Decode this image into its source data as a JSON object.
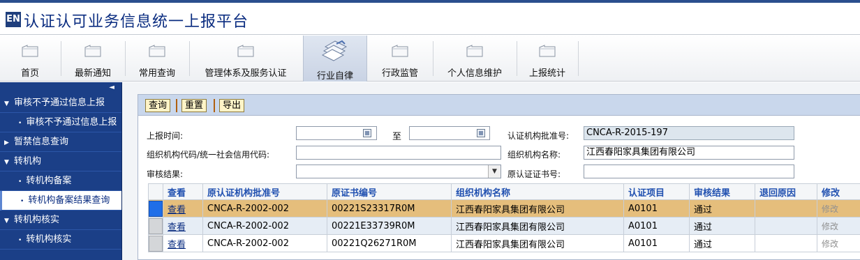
{
  "app": {
    "logo_text": "EN",
    "title": "认证认可业务信息统一上报平台"
  },
  "toolbar": {
    "items": [
      {
        "label": "首页",
        "icon": "folder-icon"
      },
      {
        "label": "最新通知",
        "icon": "folder-icon"
      },
      {
        "label": "常用查询",
        "icon": "folder-icon"
      },
      {
        "label": "管理体系及服务认证",
        "icon": "folder-icon"
      },
      {
        "label": "行业自律",
        "icon": "folder-stack-icon",
        "active": true
      },
      {
        "label": "行政监管",
        "icon": "folder-icon"
      },
      {
        "label": "个人信息维护",
        "icon": "folder-icon"
      },
      {
        "label": "上报统计",
        "icon": "folder-icon"
      }
    ]
  },
  "sidebar": {
    "collapse_glyph": "◄",
    "items": [
      {
        "label": "审核不予通过信息上报",
        "level": 0,
        "expanded": true
      },
      {
        "label": "审核不予通过信息上报",
        "level": 1
      },
      {
        "label": "暂禁信息查询",
        "level": 0,
        "expanded": false
      },
      {
        "label": "转机构",
        "level": 0,
        "expanded": true
      },
      {
        "label": "转机构备案",
        "level": 1
      },
      {
        "label": "转机构备案结果查询",
        "level": 1,
        "selected": true
      },
      {
        "label": "转机构核实",
        "level": 0,
        "expanded": true
      },
      {
        "label": "转机构核实",
        "level": 1
      }
    ]
  },
  "buttons": {
    "query": "查询",
    "reset": "重置",
    "export": "导出"
  },
  "form": {
    "report_time_label": "上报时间:",
    "report_time_from": "",
    "to_label": "至",
    "report_time_to": "",
    "approval_no_label": "认证机构批准号:",
    "approval_no_value": "CNCA-R-2015-197",
    "org_code_label": "组织机构代码/统一社会信用代码:",
    "org_code_value": "",
    "org_name_label": "组织机构名称:",
    "org_name_value": "江西春阳家具集团有限公司",
    "review_result_label": "审核结果:",
    "review_result_value": "",
    "orig_cert_no_label": "原认证证书号:",
    "orig_cert_no_value": ""
  },
  "table": {
    "headers": [
      "查看",
      "原认证机构批准号",
      "原证书编号",
      "组织机构名称",
      "认证项目",
      "审核结果",
      "退回原因",
      "修改"
    ],
    "rows": [
      {
        "view": "查看",
        "approval_no": "CNCA-R-2002-002",
        "cert_no": "00221S23317R0M",
        "org_name": "江西春阳家具集团有限公司",
        "project": "A0101",
        "result": "通过",
        "reason": "",
        "modify": "修改"
      },
      {
        "view": "查看",
        "approval_no": "CNCA-R-2002-002",
        "cert_no": "00221E33739R0M",
        "org_name": "江西春阳家具集团有限公司",
        "project": "A0101",
        "result": "通过",
        "reason": "",
        "modify": "修改"
      },
      {
        "view": "查看",
        "approval_no": "CNCA-R-2002-002",
        "cert_no": "00221Q26271R0M",
        "org_name": "江西春阳家具集团有限公司",
        "project": "A0101",
        "result": "通过",
        "reason": "",
        "modify": "修改"
      }
    ]
  },
  "colors": {
    "brand_blue": "#1b3f87",
    "title_blue": "#0a2c80",
    "selected_row": "#e5be7c",
    "header_blue": "#2050b0"
  }
}
